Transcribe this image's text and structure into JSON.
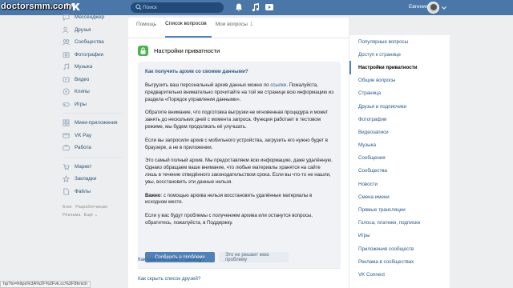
{
  "watermark": "doctorsmm.com",
  "topbar": {
    "logo": "VK",
    "search_placeholder": "Поиск",
    "user_name": "Евгения"
  },
  "sidebar": {
    "items": [
      {
        "label": "Мессенджер",
        "icon": "chat-icon"
      },
      {
        "label": "Друзья",
        "icon": "friends-icon"
      },
      {
        "label": "Сообщества",
        "icon": "groups-icon"
      },
      {
        "label": "Фотографии",
        "icon": "photo-icon"
      },
      {
        "label": "Музыка",
        "icon": "music-icon"
      },
      {
        "label": "Видео",
        "icon": "video-icon"
      },
      {
        "label": "Клипы",
        "icon": "clips-icon"
      },
      {
        "label": "Игры",
        "icon": "games-icon"
      }
    ],
    "items2": [
      {
        "label": "Мини-приложения",
        "icon": "apps-icon"
      },
      {
        "label": "VK Pay",
        "icon": "vkpay-icon"
      },
      {
        "label": "Работа",
        "icon": "work-icon"
      }
    ],
    "items3": [
      {
        "label": "Маркет",
        "icon": "market-icon"
      },
      {
        "label": "Закладки",
        "icon": "bookmark-icon"
      },
      {
        "label": "Файлы",
        "icon": "files-icon"
      }
    ],
    "footer": [
      "Блог",
      "Разработчикам",
      "Реклама",
      "Ещё ⌄"
    ]
  },
  "tabs": [
    {
      "label": "Помощь",
      "count": ""
    },
    {
      "label": "Список вопросов",
      "count": ""
    },
    {
      "label": "Мои вопросы",
      "count": "1"
    }
  ],
  "section_title": "Настройки приватности",
  "article": {
    "question": "Как получить архив со своими данными?",
    "p1_a": "Выгрузить ваш персональный архив данных можно по ",
    "p1_link": "ссылке",
    "p1_b": ". Пожалуйста, предварительно внимательно прочитайте на той же странице всю информацию из раздела «Порядок управления данными».",
    "p2": "Обратите внимание, что подготовка выгрузки не мгновенная процедура и может занять до нескольких дней с момента запроса. Функция работает в тестовом режиме, мы будем продолжать её улучшать.",
    "p3": "Если вы запросили архив с мобильного устройства, загрузить его нужно будет в браузере, а не в приложении.",
    "p4": "Это самый полный архив. Мы предоставляем всю информацию, даже удалённую. Однако обращаем ваше внимание, что любые материалы хранятся на сайте лишь в течение отведённого законодательством срока. Если вы что-то не нашли, увы, восстановить эти данные нельзя.",
    "p5_bold": "Важно",
    "p5": ": с помощью архива нельзя восстановить удалённые материалы в исходном месте.",
    "p6": "Если у вас будут проблемы с получением архива или останутся вопросы, обратитесь, пожалуйста, в Поддержку.",
    "btn_report": "Сообщить о проблеме",
    "btn_not_solved": "Это не решает мою проблему"
  },
  "faq": [
    "Как удалить свою страницу?",
    "Как скрыть список друзей?"
  ],
  "right_menu": [
    {
      "label": "Популярные вопросы",
      "active": false
    },
    {
      "label": "Доступ к странице",
      "active": false
    },
    {
      "label": "Настройки приватности",
      "active": true
    },
    {
      "label": "Общие вопросы",
      "active": false
    },
    {
      "label": "Страница",
      "active": false
    },
    {
      "label": "Друзья и подписчики",
      "active": false
    },
    {
      "label": "Фотографии",
      "active": false
    },
    {
      "label": "Видеозаписи",
      "active": false
    },
    {
      "label": "Музыка",
      "active": false
    },
    {
      "label": "Сообщения",
      "active": false
    },
    {
      "label": "Сообщества",
      "active": false
    },
    {
      "label": "Новости",
      "active": false
    },
    {
      "label": "Смена имени",
      "active": false
    },
    {
      "label": "Прямые трансляции",
      "active": false
    },
    {
      "label": "Голоса, платежи, подписки",
      "active": false
    },
    {
      "label": "Игры",
      "active": false
    },
    {
      "label": "Приложения сообществ",
      "active": false
    },
    {
      "label": "Реклама в сообществах",
      "active": false
    },
    {
      "label": "VK Connect",
      "active": false
    }
  ],
  "status_url": "hp?to=https%3A%2F%2Fvk.cc%2F8Irnich",
  "colors": {
    "header_bg": "#4a76a8",
    "link": "#2a5885",
    "primary_btn": "#5181b8",
    "lock_green": "#4bb34b"
  }
}
